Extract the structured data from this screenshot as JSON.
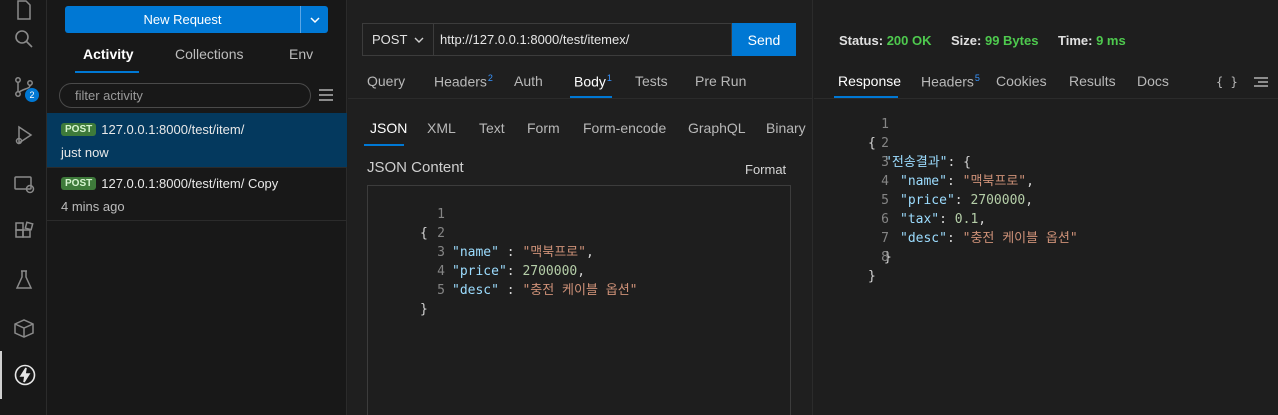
{
  "sidebar": {
    "new_request_label": "New Request",
    "tabs": [
      "Activity",
      "Collections",
      "Env"
    ],
    "filter_placeholder": "filter activity",
    "history": [
      {
        "method": "POST",
        "url": "127.0.0.1:8000/test/item/",
        "time": "just now"
      },
      {
        "method": "POST",
        "url": "127.0.0.1:8000/test/item/ Copy",
        "time": "4 mins ago"
      }
    ]
  },
  "activity_bar": {
    "icons": [
      "files-icon",
      "search-icon",
      "source-control-icon",
      "run-debug-icon",
      "remote-explorer-icon",
      "extensions-icon",
      "testing-icon",
      "package-icon",
      "thunder-client-icon"
    ],
    "source_control_badge": "2"
  },
  "request": {
    "method": "POST",
    "url": "http://127.0.0.1:8000/test/itemex/",
    "send_label": "Send",
    "tabs": {
      "query": "Query",
      "headers": "Headers",
      "headers_count": "2",
      "auth": "Auth",
      "body": "Body",
      "body_count": "1",
      "tests": "Tests",
      "prerun": "Pre Run"
    },
    "body_tabs": [
      "JSON",
      "XML",
      "Text",
      "Form",
      "Form-encode",
      "GraphQL",
      "Binary"
    ],
    "json_content_label": "JSON Content",
    "format_label": "Format",
    "line_numbers": [
      "1",
      "2",
      "3",
      "4",
      "5"
    ],
    "body_lines": {
      "l1": "{",
      "l2_key": "\"name\"",
      "l2_sep": " : ",
      "l2_val": "\"맥북프로\"",
      "l2_end": ",",
      "l3_key": "\"price\"",
      "l3_sep": ": ",
      "l3_val": "2700000",
      "l3_end": ",",
      "l4_key": "\"desc\"",
      "l4_sep": " : ",
      "l4_val": "\"충전 케이블 옵션\"",
      "l5": "}"
    }
  },
  "response": {
    "status_label": "Status:",
    "status_value": "200 OK",
    "size_label": "Size:",
    "size_value": "99 Bytes",
    "time_label": "Time:",
    "time_value": "9 ms",
    "tabs": {
      "response": "Response",
      "headers": "Headers",
      "headers_count": "5",
      "cookies": "Cookies",
      "results": "Results",
      "docs": "Docs",
      "braces": "{ }"
    },
    "line_numbers": [
      "1",
      "2",
      "3",
      "4",
      "5",
      "6",
      "7",
      "8"
    ],
    "lines": {
      "l1": "{",
      "l2_key": "\"전송결과\"",
      "l2_end": ": {",
      "l3_key": "\"name\"",
      "l3_val": "\"맥북프로\"",
      "l4_key": "\"price\"",
      "l4_val": "2700000",
      "l5_key": "\"tax\"",
      "l5_val": "0.1",
      "l6_key": "\"desc\"",
      "l6_val": "\"충전 케이블 옵션\"",
      "l7": "}",
      "l8": "}",
      "colon": ": ",
      "comma": ","
    }
  },
  "colors": {
    "accent": "#0078d4",
    "status_ok": "#4ec94e",
    "json_key": "#9cdcfe",
    "json_string": "#ce9178",
    "json_number": "#b5cea8"
  }
}
